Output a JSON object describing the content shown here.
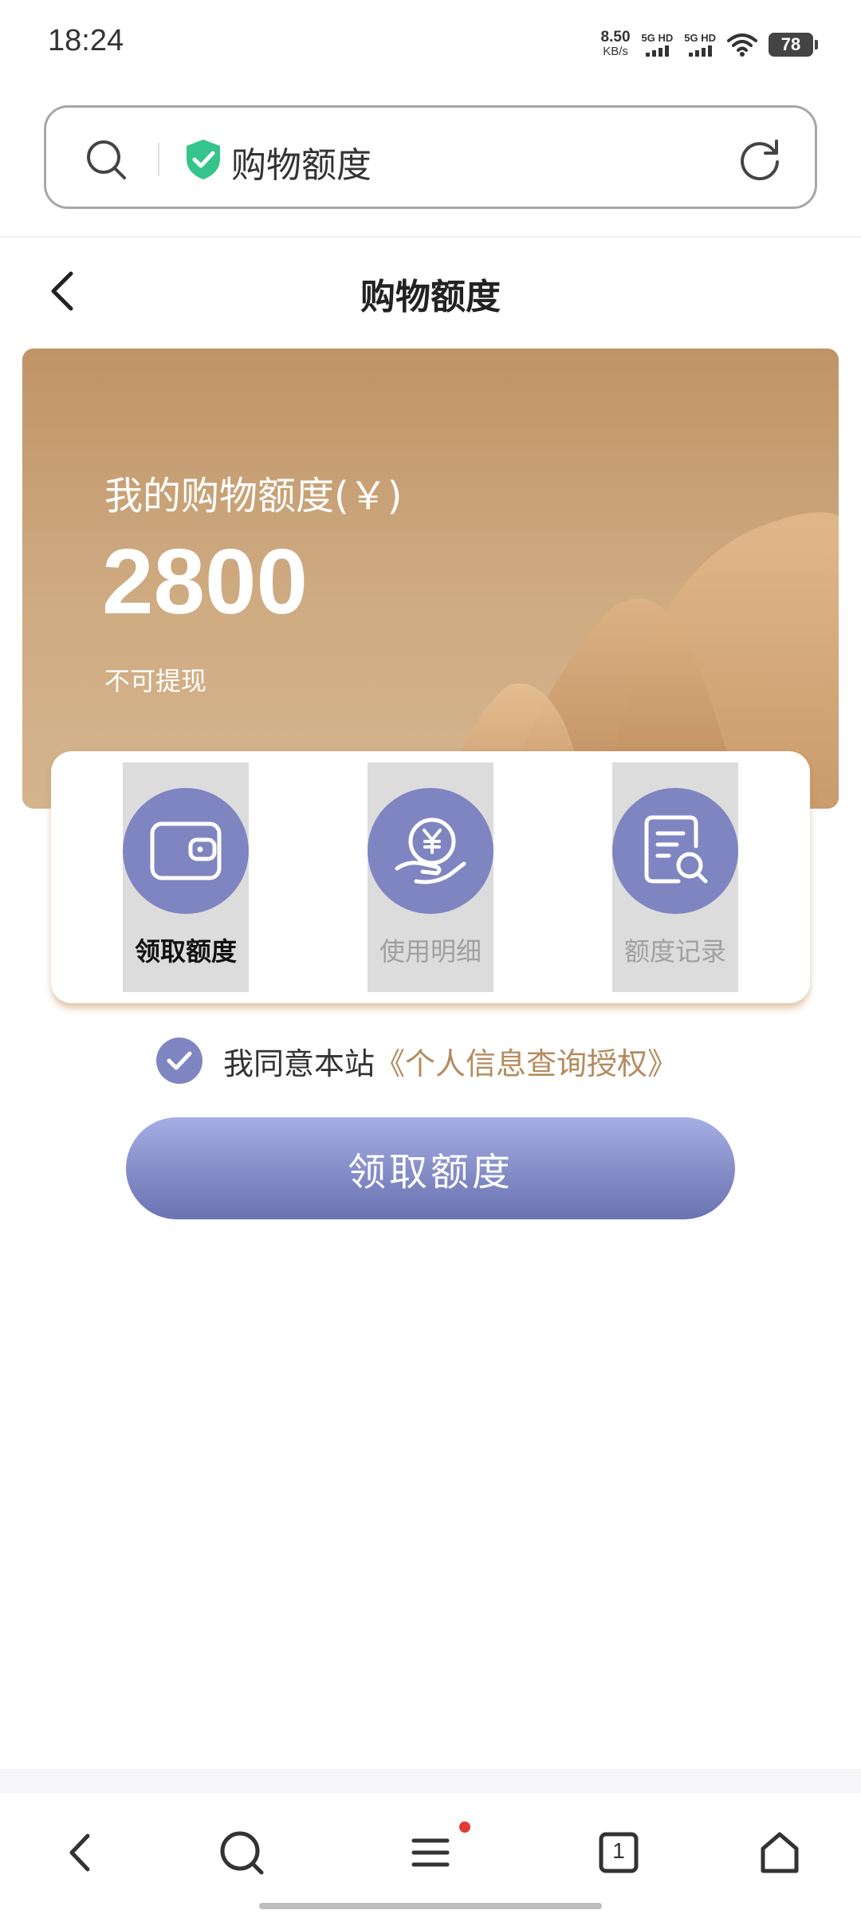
{
  "status_bar": {
    "time": "18:24",
    "net_speed_value": "8.50",
    "net_speed_unit": "KB/s",
    "sim1_label": "5G HD",
    "sim2_label": "5G HD",
    "battery": "78"
  },
  "browser": {
    "url_text": "购物额度",
    "icons": {
      "search": "search-icon",
      "secure": "shield-check-icon",
      "refresh": "refresh-icon"
    },
    "secure_color": "#35c48a"
  },
  "header": {
    "title": "购物额度"
  },
  "banner": {
    "label": "我的购物额度(￥)",
    "amount": "2800",
    "note": "不可提现",
    "colors": {
      "top": "#bf9467",
      "bottom": "#d5b48d"
    }
  },
  "actions": [
    {
      "label": "领取额度",
      "icon": "wallet-icon",
      "active": true
    },
    {
      "label": "使用明细",
      "icon": "yuan-hand-icon",
      "active": false
    },
    {
      "label": "额度记录",
      "icon": "document-search-icon",
      "active": false
    }
  ],
  "agreement": {
    "prefix": "我同意本站",
    "link": "《个人信息查询授权》",
    "checked": true
  },
  "primary_button": {
    "label": "领取额度"
  },
  "accent_color": "#7e85c1",
  "bottom_nav": {
    "tab_count": "1",
    "icons": [
      "back-icon",
      "search-icon",
      "menu-icon",
      "tabs-icon",
      "home-icon"
    ],
    "menu_has_notification": true
  }
}
